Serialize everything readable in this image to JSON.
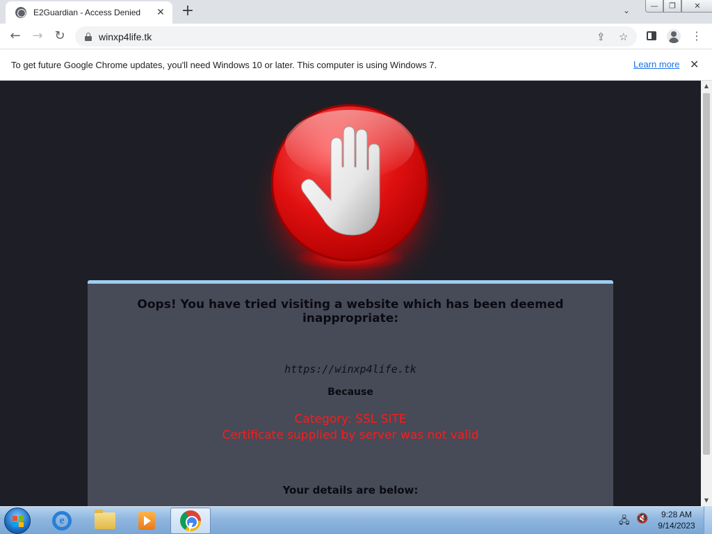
{
  "browser": {
    "tab": {
      "title": "E2Guardian - Access Denied",
      "favicon_icon": "globe-icon",
      "close_symbol": "✕"
    },
    "new_tab_symbol": "+",
    "tab_dropdown_symbol": "⌄",
    "window_controls": {
      "minimize": "—",
      "maximize": "❐",
      "close": "✕"
    },
    "toolbar": {
      "back_symbol": "←",
      "forward_symbol": "→",
      "reload_symbol": "↻",
      "url": "winxp4life.tk",
      "share_symbol": "⇪",
      "bookmark_symbol": "☆",
      "menu_symbol": "⋮"
    },
    "infobar": {
      "message": "To get future Google Chrome updates, you'll need Windows 10 or later. This computer is using Windows 7.",
      "link_label": "Learn more",
      "close_symbol": "✕"
    }
  },
  "page": {
    "heading": "Oops! You have tried visiting a website which has been deemed inappropriate:",
    "blocked_url": "https://winxp4life.tk",
    "because_label": "Because",
    "category_line": "Category: SSL SITE",
    "reason_line": "Certificate supplied by server was not valid",
    "details_label": "Your details are below:",
    "colors": {
      "background": "#1e1f26",
      "panel": "#474a57",
      "panel_border": "#9ecdf2",
      "reason_text": "#ff1a1a"
    }
  },
  "scrollbar": {
    "up_symbol": "▲",
    "down_symbol": "▼"
  },
  "taskbar": {
    "pinned": [
      "internet-explorer-icon",
      "windows-explorer-icon",
      "media-player-icon",
      "chrome-icon"
    ],
    "active": "chrome-icon",
    "tray": {
      "network_symbol": "🖧",
      "volume_symbol": "🔇"
    },
    "clock": {
      "time": "9:28 AM",
      "date": "9/14/2023"
    }
  }
}
